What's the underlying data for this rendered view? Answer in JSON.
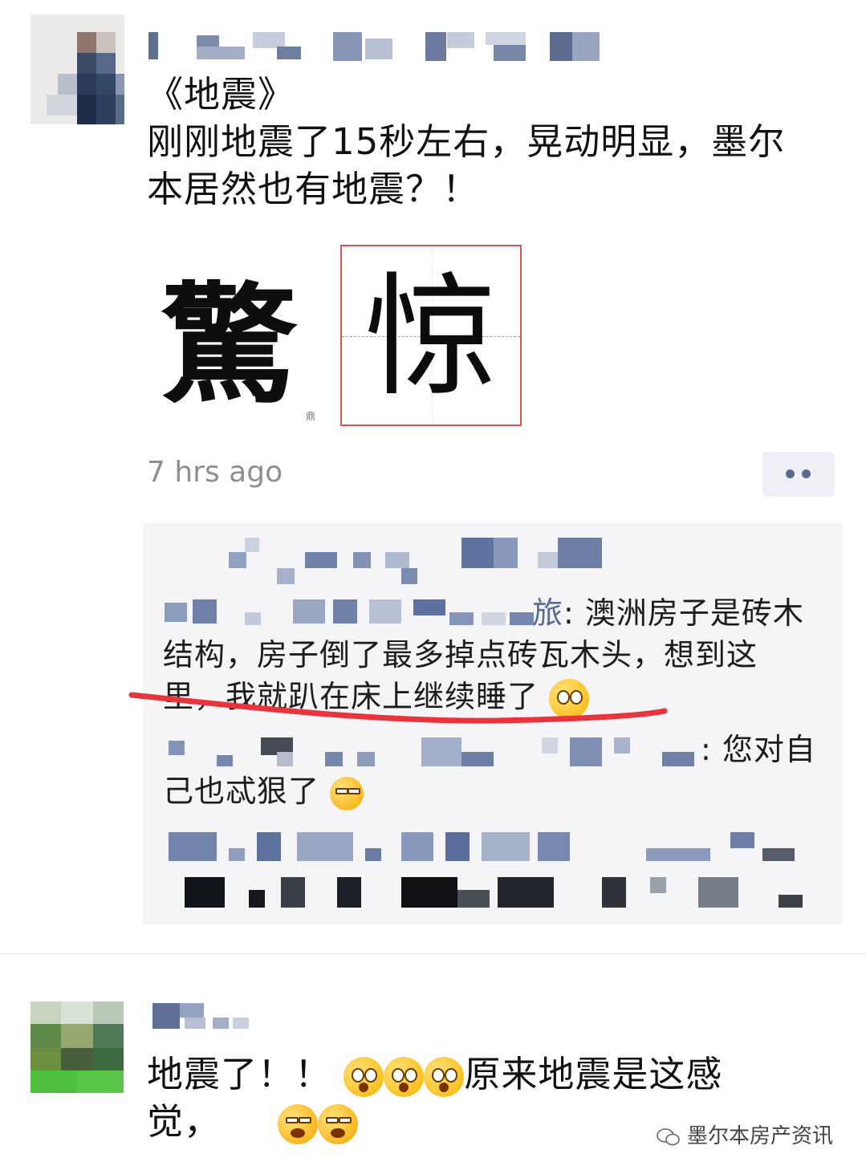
{
  "post1": {
    "line1": "《地震》",
    "line2": "刚刚地震了15秒左右，晃动明显，墨尔",
    "line3": "本居然也有地震？！",
    "image_char_left": "驚",
    "image_char_right": "惊",
    "timestamp": "7 hrs ago"
  },
  "comments": [
    {
      "author_tail": "旅",
      "sep": ": ",
      "line1": "澳洲房子是砖木",
      "line2": "结构，房子倒了最多掉点砖瓦木头，想到这",
      "line3": "里，我就趴在床上继续睡了"
    },
    {
      "sep": ": ",
      "line1": "您对自",
      "line2": "己也忒狠了"
    }
  ],
  "post2": {
    "line1_a": "地震了！！",
    "line1_b": "原来地震是这感",
    "line2": "觉，"
  },
  "watermark": "墨尔本房产资讯",
  "icons": {
    "more": "more-dots-icon",
    "emoji_think": "thinking-face-emoji",
    "emoji_sweat": "sweat-face-emoji",
    "emoji_shock": "shocked-face-emoji",
    "emoji_cry": "crying-face-emoji",
    "watermark": "wechat-logo-icon"
  },
  "colors": {
    "author_link": "#576b95",
    "underline": "#e8343c",
    "comment_bg": "#f5f5f7"
  }
}
